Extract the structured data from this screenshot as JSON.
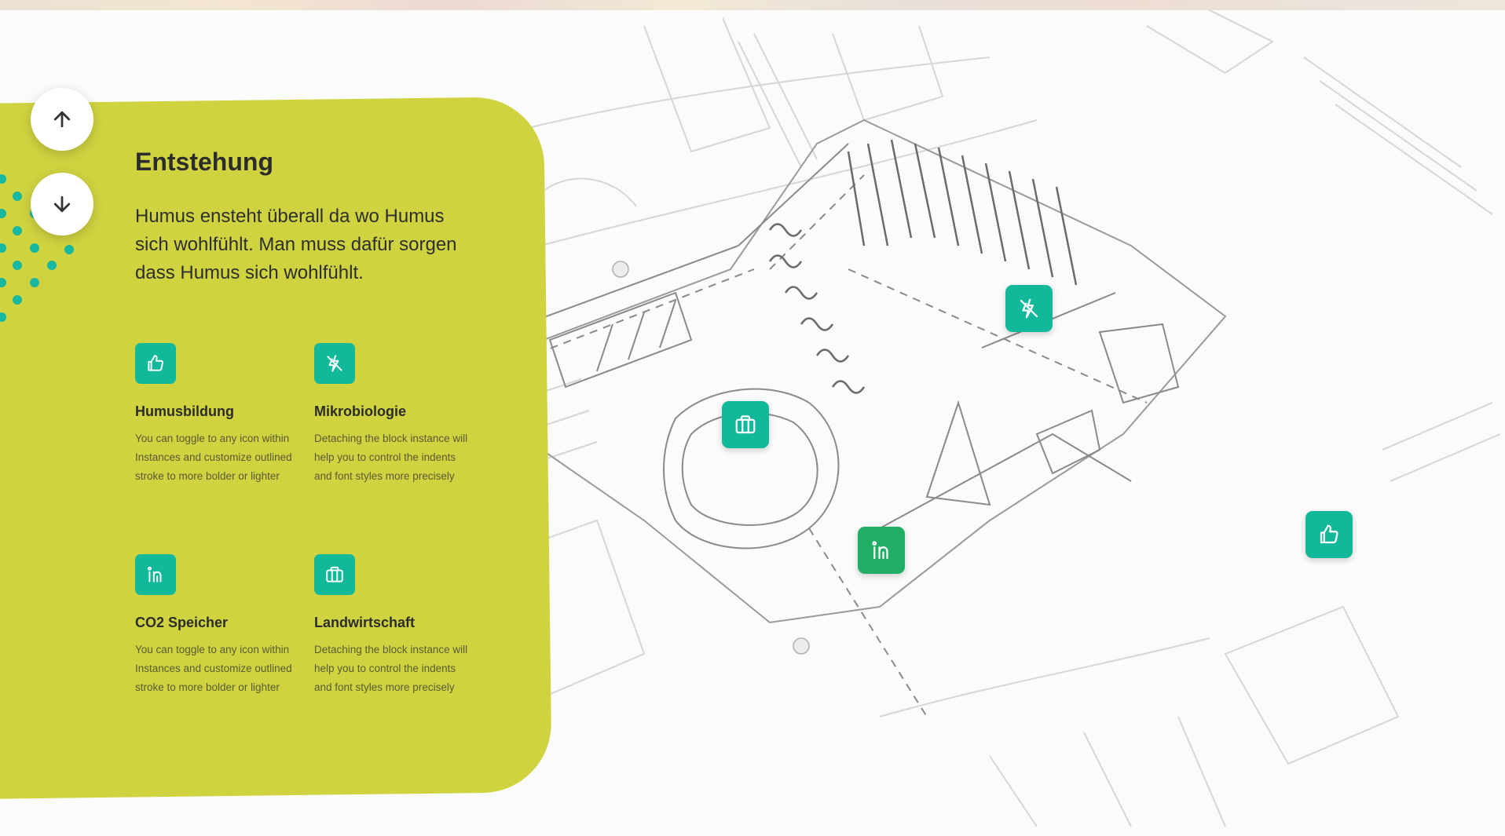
{
  "colors": {
    "panel": "#cfd340",
    "accent": "#12b89a",
    "dots": "#18b7a0"
  },
  "nav": {
    "up_icon": "arrow-up-icon",
    "down_icon": "arrow-down-icon"
  },
  "section": {
    "title": "Entstehung",
    "intro": "Humus ensteht überall da wo Humus sich wohlfühlt. Man muss dafür sorgen dass Humus sich wohlfühlt."
  },
  "features": [
    {
      "icon": "thumbs-up-icon",
      "title": "Humusbildung",
      "description": "You can toggle to any icon within Instances and customize outlined stroke to more bolder or lighter"
    },
    {
      "icon": "lightning-off-icon",
      "title": "Mikrobiologie",
      "description": "Detaching the block instance will help you to control the indents and font styles more precisely"
    },
    {
      "icon": "linkedin-icon",
      "title": "CO2 Speicher",
      "description": "You can toggle to any icon within Instances and customize outlined stroke to more bolder or lighter"
    },
    {
      "icon": "briefcase-icon",
      "title": "Landwirtschaft",
      "description": "Detaching the block instance will help you to control the indents and font styles more precisely"
    }
  ],
  "map_pins": [
    {
      "icon": "lightning-off-icon"
    },
    {
      "icon": "briefcase-icon"
    },
    {
      "icon": "linkedin-icon"
    },
    {
      "icon": "thumbs-up-icon"
    }
  ]
}
